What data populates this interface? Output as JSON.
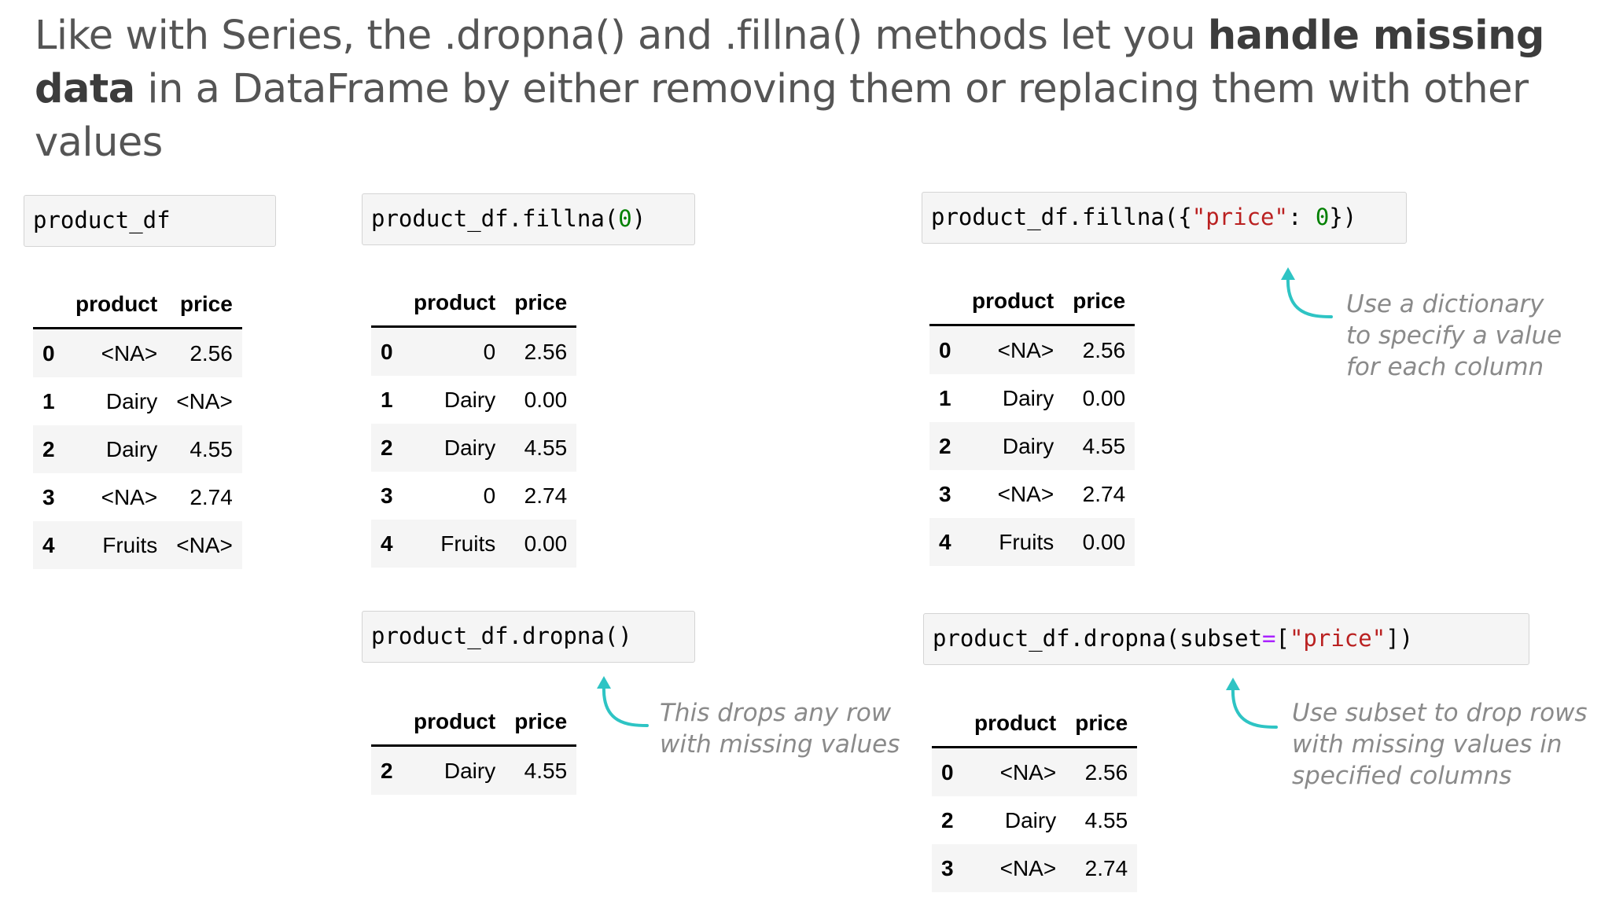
{
  "headline": {
    "lead": "Like with Series, the .dropna() and .fillna() methods let you ",
    "emphasis": "handle missing data",
    "rest": " in a DataFrame by either removing them or replacing them with other values"
  },
  "code": {
    "c1": [
      "product_df"
    ],
    "c2": [
      "product_df.fillna(",
      "0",
      ")"
    ],
    "c3": [
      "product_df.fillna({",
      "\"price\"",
      ": ",
      "0",
      "})"
    ],
    "c4": [
      "product_df.dropna()"
    ],
    "c5": [
      "product_df.dropna(subset",
      "=",
      "[",
      "\"price\"",
      "])"
    ]
  },
  "tables": {
    "t1": {
      "columns": [
        "product",
        "price"
      ],
      "rows": [
        {
          "index": "0",
          "product": "<NA>",
          "price": "2.56"
        },
        {
          "index": "1",
          "product": "Dairy",
          "price": "<NA>"
        },
        {
          "index": "2",
          "product": "Dairy",
          "price": "4.55"
        },
        {
          "index": "3",
          "product": "<NA>",
          "price": "2.74"
        },
        {
          "index": "4",
          "product": "Fruits",
          "price": "<NA>"
        }
      ]
    },
    "t2": {
      "columns": [
        "product",
        "price"
      ],
      "rows": [
        {
          "index": "0",
          "product": "0",
          "price": "2.56"
        },
        {
          "index": "1",
          "product": "Dairy",
          "price": "0.00"
        },
        {
          "index": "2",
          "product": "Dairy",
          "price": "4.55"
        },
        {
          "index": "3",
          "product": "0",
          "price": "2.74"
        },
        {
          "index": "4",
          "product": "Fruits",
          "price": "0.00"
        }
      ]
    },
    "t3": {
      "columns": [
        "product",
        "price"
      ],
      "rows": [
        {
          "index": "0",
          "product": "<NA>",
          "price": "2.56"
        },
        {
          "index": "1",
          "product": "Dairy",
          "price": "0.00"
        },
        {
          "index": "2",
          "product": "Dairy",
          "price": "4.55"
        },
        {
          "index": "3",
          "product": "<NA>",
          "price": "2.74"
        },
        {
          "index": "4",
          "product": "Fruits",
          "price": "0.00"
        }
      ]
    },
    "t4": {
      "columns": [
        "product",
        "price"
      ],
      "rows": [
        {
          "index": "2",
          "product": "Dairy",
          "price": "4.55"
        }
      ]
    },
    "t5": {
      "columns": [
        "product",
        "price"
      ],
      "rows": [
        {
          "index": "0",
          "product": "<NA>",
          "price": "2.56"
        },
        {
          "index": "2",
          "product": "Dairy",
          "price": "4.55"
        },
        {
          "index": "3",
          "product": "<NA>",
          "price": "2.74"
        }
      ]
    }
  },
  "notes": {
    "fillna_dict": [
      "Use a dictionary",
      "to specify a value",
      "for each column"
    ],
    "dropna": [
      "This drops any row",
      "with missing values"
    ],
    "dropna_subset": [
      "Use subset to drop rows",
      "with missing values in",
      "specified columns"
    ]
  },
  "colors": {
    "accent_arrow": "#2ec4c4",
    "string_literal": "#ba2121",
    "number_literal": "#008000",
    "operator": "#aa22ff",
    "headline_text": "#555555",
    "note_text": "#8a8a8a"
  }
}
